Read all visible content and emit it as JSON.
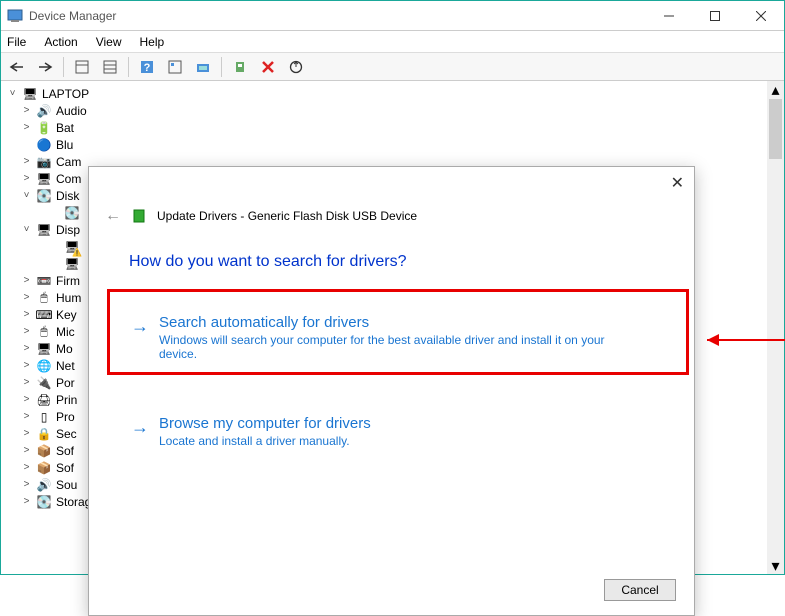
{
  "window": {
    "title": "Device Manager",
    "menu": [
      "File",
      "Action",
      "View",
      "Help"
    ]
  },
  "tree": {
    "root": "LAPTOP",
    "items": [
      {
        "exp": ">",
        "icon": "🔊",
        "label": "Audio"
      },
      {
        "exp": ">",
        "icon": "🔋",
        "label": "Bat"
      },
      {
        "exp": " ",
        "icon": "🔵",
        "label": "Blu"
      },
      {
        "exp": ">",
        "icon": "📷",
        "label": "Cam"
      },
      {
        "exp": ">",
        "icon": "🖥",
        "label": "Com"
      },
      {
        "exp": "v",
        "icon": "💽",
        "label": "Disk"
      },
      {
        "exp": "v",
        "icon": "🖥",
        "label": "Disp",
        "warn": true
      },
      {
        "exp": ">",
        "icon": "📼",
        "label": "Firm"
      },
      {
        "exp": ">",
        "icon": "🖱",
        "label": "Hum"
      },
      {
        "exp": ">",
        "icon": "⌨",
        "label": "Key"
      },
      {
        "exp": ">",
        "icon": "🖱",
        "label": "Mic"
      },
      {
        "exp": ">",
        "icon": "🖥",
        "label": "Mo"
      },
      {
        "exp": ">",
        "icon": "🌐",
        "label": "Net"
      },
      {
        "exp": ">",
        "icon": "🔌",
        "label": "Por"
      },
      {
        "exp": ">",
        "icon": "🖨",
        "label": "Prin"
      },
      {
        "exp": ">",
        "icon": "▯",
        "label": "Pro"
      },
      {
        "exp": ">",
        "icon": "🔒",
        "label": "Sec"
      },
      {
        "exp": ">",
        "icon": "📦",
        "label": "Sof"
      },
      {
        "exp": ">",
        "icon": "📦",
        "label": "Sof"
      },
      {
        "exp": ">",
        "icon": "🔊",
        "label": "Sou"
      },
      {
        "exp": ">",
        "icon": "💽",
        "label": "Storage controllers"
      }
    ]
  },
  "dialog": {
    "header": "Update Drivers - Generic Flash Disk USB Device",
    "heading": "How do you want to search for drivers?",
    "opt1_title": "Search automatically for drivers",
    "opt1_sub": "Windows will search your computer for the best available driver and install it on your device.",
    "opt2_title": "Browse my computer for drivers",
    "opt2_sub": "Locate and install a driver manually.",
    "cancel": "Cancel"
  }
}
